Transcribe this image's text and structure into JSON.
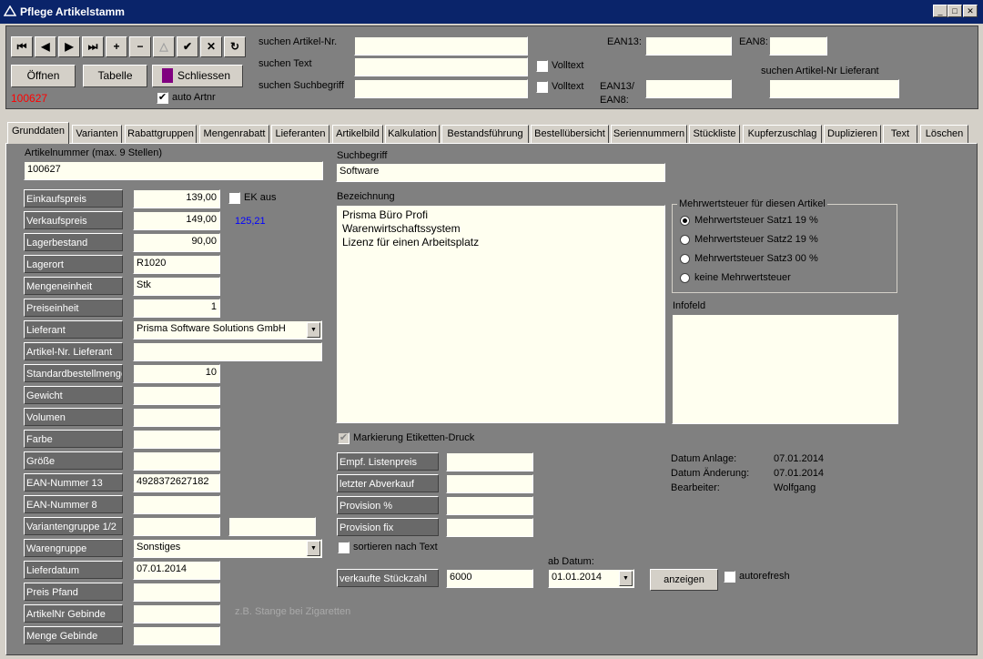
{
  "window": {
    "title": "Pflege Artikelstamm"
  },
  "toolbar": {
    "nav_buttons": [
      "⏮",
      "◀",
      "▶",
      "⏭",
      "+",
      "−",
      "△",
      "✔",
      "✕",
      "↻"
    ],
    "open_label": "Öffnen",
    "table_label": "Tabelle",
    "close_label": "Schliessen",
    "record_number": "100627",
    "auto_artnr_label": "auto Artnr"
  },
  "search": {
    "artikel_nr_label": "suchen Artikel-Nr.",
    "text_label": "suchen Text",
    "suchbegriff_label": "suchen Suchbegriff",
    "volltext_label": "Volltext",
    "ean13_label": "EAN13:",
    "ean8_label": "EAN8:",
    "ean13_8_label": "EAN13/",
    "ean13_8_label2": "EAN8:",
    "lieferant_label": "suchen Artikel-Nr Lieferant"
  },
  "tabs": [
    "Grunddaten",
    "Varianten",
    "Rabattgruppen",
    "Mengenrabatt",
    "Lieferanten",
    "Artikelbild",
    "Kalkulation",
    "Bestandsführung",
    "Bestellübersicht",
    "Seriennummern",
    "Stückliste",
    "Kupferzuschlag",
    "Duplizieren",
    "Text",
    "Löschen"
  ],
  "form": {
    "artikelnummer_label": "Artikelnummer (max. 9 Stellen)",
    "artikelnummer": "100627",
    "suchbegriff_label": "Suchbegriff",
    "suchbegriff": "Software",
    "bezeichnung_label": "Bezeichnung",
    "bezeichnung": [
      "Prisma Büro Profi",
      "Warenwirtschaftssystem",
      "Lizenz für einen Arbeitsplatz"
    ],
    "ek_aus_label": "EK aus",
    "net_price": "125,21",
    "fields": [
      {
        "label": "Einkaufspreis",
        "value": "139,00"
      },
      {
        "label": "Verkaufspreis",
        "value": "149,00"
      },
      {
        "label": "Lagerbestand",
        "value": "90,00"
      },
      {
        "label": "Lagerort",
        "value": "R1020"
      },
      {
        "label": "Mengeneinheit",
        "value": "Stk"
      },
      {
        "label": "Preiseinheit",
        "value": "1"
      },
      {
        "label": "Lieferant",
        "value": "Prisma Software Solutions GmbH"
      },
      {
        "label": "Artikel-Nr. Lieferant",
        "value": ""
      },
      {
        "label": "Standardbestellmenge",
        "value": "10"
      },
      {
        "label": "Gewicht",
        "value": ""
      },
      {
        "label": "Volumen",
        "value": ""
      },
      {
        "label": "Farbe",
        "value": ""
      },
      {
        "label": "Größe",
        "value": ""
      },
      {
        "label": "EAN-Nummer 13",
        "value": "4928372627182"
      },
      {
        "label": "EAN-Nummer 8",
        "value": ""
      },
      {
        "label": "Variantengruppe 1/2",
        "value": ""
      },
      {
        "label": "Warengruppe",
        "value": "Sonstiges"
      },
      {
        "label": "Lieferdatum",
        "value": "07.01.2014"
      },
      {
        "label": "Preis Pfand",
        "value": ""
      },
      {
        "label": "ArtikelNr Gebinde",
        "value": ""
      },
      {
        "label": "Menge Gebinde",
        "value": ""
      }
    ],
    "gebinde_hint": "z.B. Stange bei Zigaretten",
    "mwst_group_label": "Mehrwertsteuer für diesen Artikel",
    "mwst_options": [
      "Mehrwertsteuer Satz1  19 %",
      "Mehrwertsteuer Satz2  19 %",
      "Mehrwertsteuer Satz3  00 %",
      "keine Mehrwertsteuer"
    ],
    "infofeld_label": "Infofeld",
    "etiketten_label": "Markierung Etiketten-Druck",
    "extra_fields": [
      {
        "label": "Empf. Listenpreis",
        "value": ""
      },
      {
        "label": "letzter Abverkauf",
        "value": ""
      },
      {
        "label": "Provision %",
        "value": ""
      },
      {
        "label": "Provision fix",
        "value": ""
      }
    ],
    "sortieren_label": "sortieren nach Text",
    "ab_datum_label": "ab Datum:",
    "verkaufte_label": "verkaufte Stückzahl",
    "verkaufte_value": "6000",
    "ab_datum_value": "01.01.2014",
    "anzeigen_label": "anzeigen",
    "autorefresh_label": "autorefresh",
    "meta": {
      "anlage_label": "Datum Anlage:",
      "anlage": "07.01.2014",
      "aenderung_label": "Datum Änderung:",
      "aenderung": "07.01.2014",
      "bearbeiter_label": "Bearbeiter:",
      "bearbeiter": "Wolfgang"
    }
  },
  "colors": {
    "title_bar": "#0a246a",
    "field_bg": "#fffff0",
    "label_bg": "#696969",
    "panel": "#808080",
    "record_red": "#ff0000",
    "net_price_blue": "#0000ff"
  }
}
